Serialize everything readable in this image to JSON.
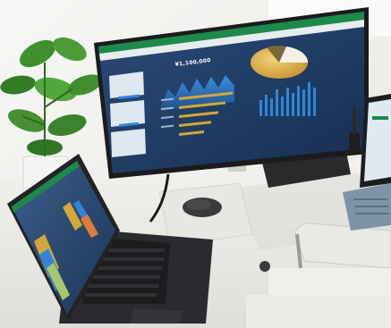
{
  "scene": {
    "monitor": {
      "headline_number": "¥1,100,000",
      "accent": "#1c8a4a",
      "dashboard_bg": "#1f3a63",
      "gold": "#d4a73a",
      "blue": "#2f86d8"
    },
    "desk_color": "#eeeeea",
    "wall_color": "#f3f3f1",
    "plant_color": "#3f8f2f"
  }
}
